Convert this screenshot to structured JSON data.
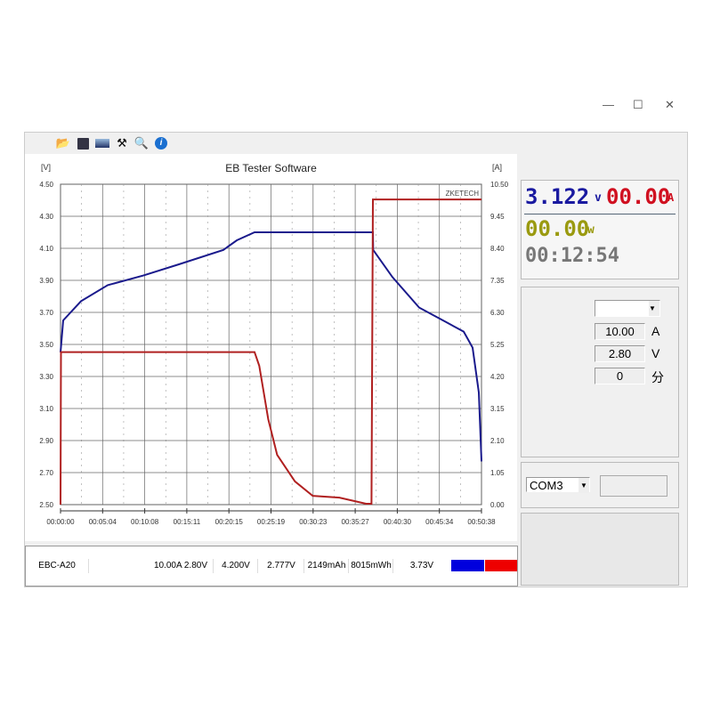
{
  "window": {
    "minimize": "—",
    "maximize": "☐",
    "close": "✕"
  },
  "toolbar": {
    "icons": [
      "folder-icon",
      "save-icon",
      "chart-icon",
      "tools-icon",
      "zoom-icon",
      "info-icon"
    ]
  },
  "chart_data": {
    "type": "line",
    "title": "EB Tester Software",
    "watermark": "ZKETECH",
    "ylabel": "[V]",
    "y2label": "[A]",
    "ylim": [
      2.5,
      4.5
    ],
    "y2lim": [
      0,
      10.5
    ],
    "xlim_minutes": [
      0,
      50.63
    ],
    "yticks": [
      "4.50",
      "4.30",
      "4.10",
      "3.90",
      "3.70",
      "3.50",
      "3.30",
      "3.10",
      "2.90",
      "2.70",
      "2.50"
    ],
    "y2ticks": [
      "10.50",
      "9.45",
      "8.40",
      "7.35",
      "6.30",
      "5.25",
      "4.20",
      "3.15",
      "2.10",
      "1.05",
      "0.00"
    ],
    "xticks": [
      "00:00:00",
      "00:05:04",
      "00:10:08",
      "00:15:11",
      "00:20:15",
      "00:25:19",
      "00:30:23",
      "00:35:27",
      "00:40:30",
      "00:45:34",
      "00:50:38"
    ],
    "grid": true,
    "series": [
      {
        "axis": "V",
        "color": "#1a1a8c",
        "x_minutes": [
          0,
          0.32,
          2.46,
          5.67,
          9.95,
          14.24,
          19.59,
          21.2,
          23.33,
          37.57,
          37.6,
          39.93,
          43.14,
          46.35,
          48.49,
          49.56,
          50.31,
          50.63
        ],
        "values": [
          3.45,
          3.65,
          3.77,
          3.87,
          3.93,
          4.0,
          4.09,
          4.15,
          4.2,
          4.2,
          4.09,
          3.92,
          3.73,
          3.64,
          3.58,
          3.48,
          3.2,
          2.77
        ]
      },
      {
        "axis": "A",
        "color": "#b02020",
        "x_minutes": [
          0,
          0.05,
          23.33,
          23.9,
          24.98,
          26.05,
          28.19,
          30.33,
          33.54,
          36.75,
          37.4,
          37.57,
          50.63
        ],
        "values": [
          0,
          5.0,
          5.0,
          4.55,
          2.8,
          1.63,
          0.76,
          0.29,
          0.23,
          0.03,
          0.03,
          10.0,
          10.0
        ]
      }
    ]
  },
  "table": {
    "cells": [
      "EBC-A20",
      "10.00A 2.80V",
      "4.200V",
      "2.777V",
      "2149mAh",
      "8015mWh",
      "3.73V"
    ],
    "colors": [
      "#0000dd",
      "#ee0000"
    ]
  },
  "display": {
    "voltage": "3.122",
    "voltage_unit": "v",
    "current": "00.00",
    "current_unit": "A",
    "power": "00.00",
    "power_unit": "w",
    "time": "00:12:54"
  },
  "settings": {
    "mode": "",
    "current": "10.00",
    "current_unit": "A",
    "voltage": "2.80",
    "voltage_unit": "V",
    "time": "0",
    "time_unit": "分"
  },
  "port": {
    "value": "COM3"
  }
}
